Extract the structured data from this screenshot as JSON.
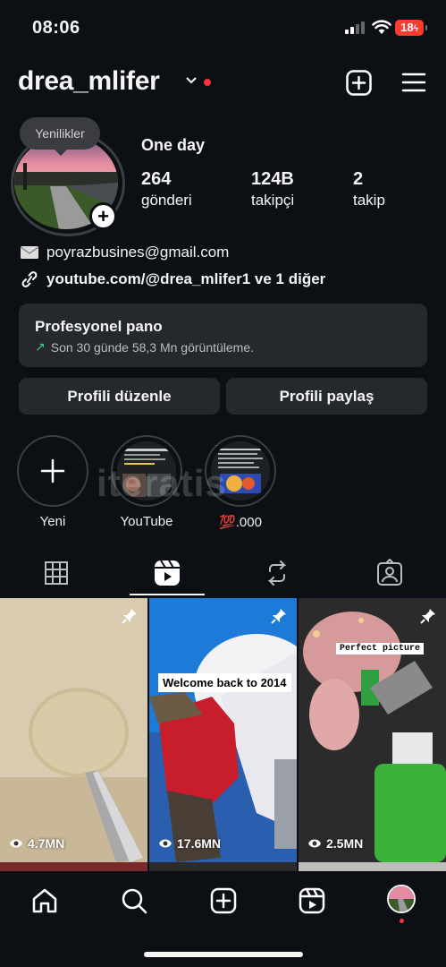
{
  "status_bar": {
    "time": "08:06",
    "battery": "18"
  },
  "header": {
    "username": "drea_mlifer"
  },
  "profile": {
    "story_bubble": "Yenilikler",
    "display_name": "One day",
    "stats": [
      {
        "value": "264",
        "label": "gönderi"
      },
      {
        "value": "124B",
        "label": "takipçi"
      },
      {
        "value": "2",
        "label": "takip"
      }
    ],
    "email": "poyrazbusines@gmail.com",
    "link": "youtube.com/@drea_mlifer1 ve 1 diğer"
  },
  "dashboard": {
    "title": "Profesyonel pano",
    "subtitle": "Son 30 günde 58,3 Mn görüntüleme."
  },
  "buttons": {
    "edit": "Profili düzenle",
    "share": "Profili paylaş"
  },
  "highlights": [
    {
      "label": "Yeni"
    },
    {
      "label": "YouTube"
    },
    {
      "label": "💯.000"
    }
  ],
  "watermark": "iteratis",
  "tabs": [
    "grid-icon",
    "reels-icon",
    "repost-icon",
    "tagged-icon"
  ],
  "posts": [
    {
      "views": "4.7MN",
      "caption": ""
    },
    {
      "views": "17.6MN",
      "caption": "Welcome back to 2014"
    },
    {
      "views": "2.5MN",
      "caption": "Perfect picture"
    }
  ],
  "colors": {
    "background": "#0c1014",
    "card": "#25292e",
    "accent_red": "#ff3040",
    "trend_green": "#4cc38a"
  }
}
